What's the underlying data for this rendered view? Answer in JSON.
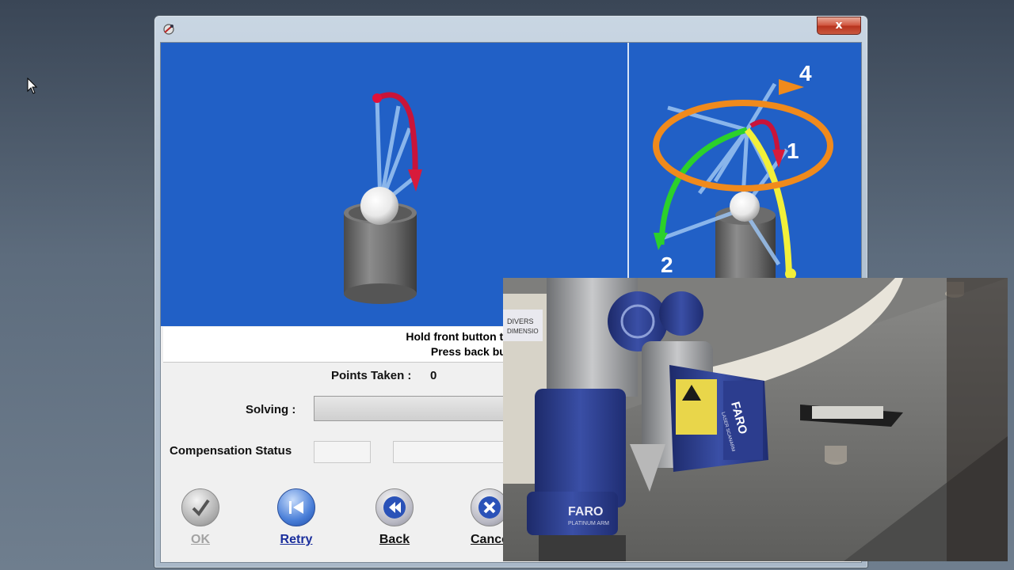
{
  "window": {
    "close_glyph": "x",
    "app_icon": "faro-app-icon"
  },
  "instruction": {
    "line1": "Hold front button to scan.  Release to pa",
    "line2": "Press back button when done."
  },
  "points": {
    "label": "Points Taken :",
    "value": "0"
  },
  "solving": {
    "label": "Solving :"
  },
  "compensation": {
    "label": "Compensation Status"
  },
  "buttons": {
    "ok": {
      "label": "OK",
      "icon": "checkmark-icon"
    },
    "retry": {
      "label": "Retry",
      "icon": "skip-back-icon"
    },
    "back": {
      "label": "Back",
      "icon": "rewind-icon"
    },
    "cancel": {
      "label": "Cance",
      "icon": "x-icon"
    }
  },
  "diagram": {
    "labels": [
      "4",
      "1",
      "2"
    ]
  },
  "video_inset": {
    "text": [
      "FARO",
      "PLATINUM ARM",
      "FARO",
      "LASER SCANARM",
      "DIVERS",
      "DIMENSIO"
    ]
  },
  "colors": {
    "viewport_blue": "#2160c6",
    "arrow_red": "#d81b3b",
    "arrow_orange": "#f08a1c",
    "arrow_green": "#2bd12b",
    "arrow_yellow": "#f2f03a",
    "faro_blue": "#2c3d8e"
  }
}
